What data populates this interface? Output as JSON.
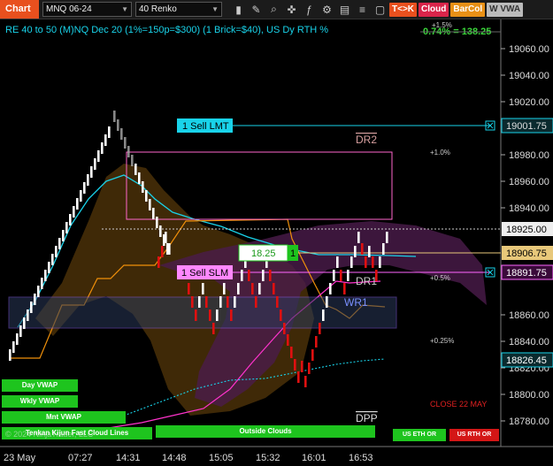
{
  "toolbar": {
    "chart_label": "Chart",
    "instrument": "MNQ 06-24",
    "bar_type": "40 Renko",
    "badge_tok": "T<>K",
    "badge_cloud": "Cloud",
    "badge_barcol": "BarCol",
    "badge_wvwa": "W VWA"
  },
  "chart": {
    "header": "RE 40 to 50 (M)NQ Dec 20 (1%=150p=$300) (1 Brick=$40), US Dy RTH %",
    "pct_readout": "0.74% = 138.25",
    "pct_top": "+1.5%",
    "pct_levels": [
      "+1.0%",
      "+0.5%",
      "+0.25%"
    ],
    "price_axis": [
      "19060.00",
      "19040.00",
      "19020.00",
      "18980.00",
      "18960.00",
      "18940.00",
      "18860.00",
      "18840.00",
      "18820.00",
      "18800.00",
      "18780.00"
    ],
    "price_tags": {
      "sell_lmt_price": "19001.75",
      "current_price": "18925.00",
      "avg_price": "18906.75",
      "sell_slm_price": "18891.75",
      "vwap_price": "18826.45"
    },
    "x_axis": [
      "23 May",
      "07:27",
      "14:31",
      "14:48",
      "15:05",
      "15:32",
      "16:01",
      "16:53"
    ],
    "orders": {
      "sell_lmt": "1 Sell LMT",
      "sell_slm": "1 Sell SLM",
      "position_pnl": "18.25",
      "position_qty": "1"
    },
    "zones": {
      "dr2": "DR2",
      "dr1": "DR1",
      "wr1": "WR1",
      "dpp": "DPP",
      "close_label": "CLOSE 22 MAY"
    },
    "bottom_buttons": {
      "day_vwap": "Day VWAP",
      "wkly_vwap": "Wkly VWAP",
      "mnt_vwap": "Mnt VWAP",
      "kijun": "Tenkan Kijun Fast Cloud Lines",
      "outside_clouds": "Outside Clouds",
      "us_eth_or": "US ETH OR",
      "us_rth_or": "US RTH OR"
    },
    "copyright": "© 2024 NinjaTrader, LLC"
  },
  "colors": {
    "up_brick": "#ffffff",
    "down_brick": "#e01010",
    "accent_cyan": "#19d3ea",
    "green": "#1ec41e",
    "magenta": "#ff66ff"
  }
}
